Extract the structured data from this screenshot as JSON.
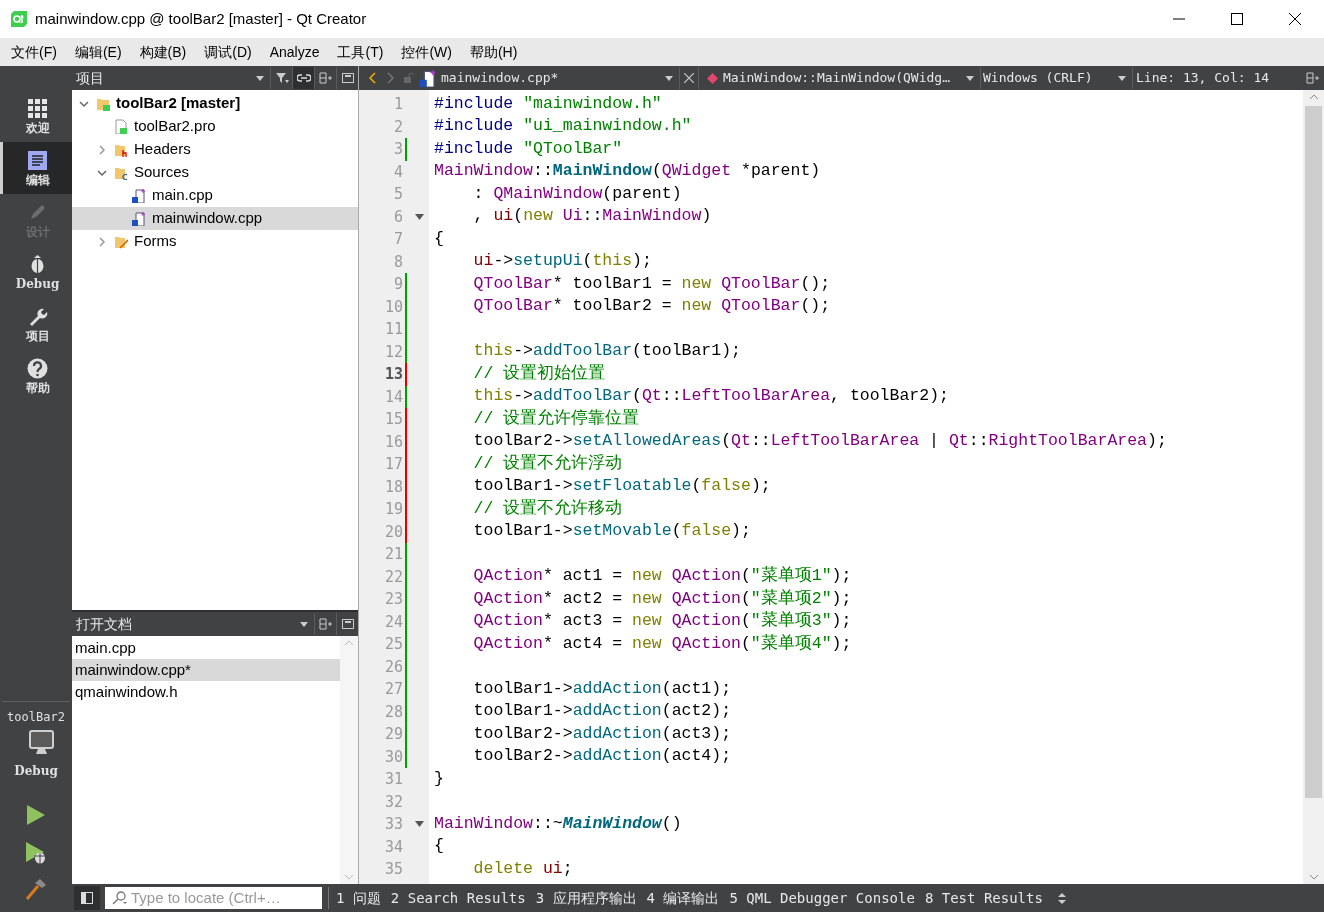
{
  "window": {
    "title": "mainwindow.cpp @ toolBar2 [master] - Qt Creator"
  },
  "menu": [
    {
      "label": "文件(F)"
    },
    {
      "label": "编辑(E)"
    },
    {
      "label": "构建(B)"
    },
    {
      "label": "调试(D)"
    },
    {
      "label": "Analyze"
    },
    {
      "label": "工具(T)"
    },
    {
      "label": "控件(W)"
    },
    {
      "label": "帮助(H)"
    }
  ],
  "mode_bar": {
    "items": [
      {
        "label": "欢迎",
        "kind": "welcome",
        "selected": false,
        "disabled": false
      },
      {
        "label": "编辑",
        "kind": "edit",
        "selected": true,
        "disabled": false
      },
      {
        "label": "设计",
        "kind": "design",
        "selected": false,
        "disabled": true
      },
      {
        "label": "Debug",
        "kind": "debug",
        "selected": false,
        "disabled": false
      },
      {
        "label": "项目",
        "kind": "projects",
        "selected": false,
        "disabled": false
      },
      {
        "label": "帮助",
        "kind": "help",
        "selected": false,
        "disabled": false
      }
    ],
    "kit": {
      "project": "toolBar2",
      "build": "Debug"
    }
  },
  "project_panel": {
    "title": "项目",
    "tree": [
      {
        "label": "toolBar2 [master]",
        "kind": "project",
        "expanded": true,
        "selected": false,
        "children": [
          {
            "label": "toolBar2.pro",
            "kind": "pro",
            "selected": false
          },
          {
            "label": "Headers",
            "kind": "headers",
            "expanded": false,
            "selected": false
          },
          {
            "label": "Sources",
            "kind": "sources",
            "expanded": true,
            "selected": false,
            "children": [
              {
                "label": "main.cpp",
                "kind": "cpp",
                "selected": false
              },
              {
                "label": "mainwindow.cpp",
                "kind": "cpp",
                "selected": true
              }
            ]
          },
          {
            "label": "Forms",
            "kind": "forms",
            "expanded": false,
            "selected": false
          }
        ]
      }
    ]
  },
  "open_documents": {
    "title": "打开文档",
    "items": [
      {
        "label": "main.cpp",
        "selected": false
      },
      {
        "label": "mainwindow.cpp*",
        "selected": true
      },
      {
        "label": "qmainwindow.h",
        "selected": false
      }
    ]
  },
  "editor": {
    "file": "mainwindow.cpp*",
    "symbol": "MainWindow::MainWindow(QWidg…",
    "line_ending": "Windows (CRLF)",
    "position": "Line: 13, Col: 14",
    "lines": [
      {
        "number": "1",
        "added": false,
        "modified": false,
        "fold": false,
        "current": false,
        "indented": false,
        "tokens": [
          {
            "kind": "preprocessor",
            "text": "#include "
          },
          {
            "kind": "string",
            "text": "\"mainwindow.h\""
          }
        ]
      },
      {
        "number": "2",
        "added": false,
        "modified": false,
        "fold": false,
        "current": false,
        "indented": false,
        "tokens": [
          {
            "kind": "preprocessor",
            "text": "#include "
          },
          {
            "kind": "string",
            "text": "\"ui_mainwindow.h\""
          }
        ]
      },
      {
        "number": "3",
        "added": true,
        "modified": false,
        "fold": false,
        "current": false,
        "indented": false,
        "tokens": [
          {
            "kind": "preprocessor",
            "text": "#include "
          },
          {
            "kind": "string",
            "text": "\"QToolBar\""
          }
        ]
      },
      {
        "number": "4",
        "added": false,
        "modified": false,
        "fold": false,
        "current": false,
        "indented": false,
        "tokens": [
          {
            "kind": "type",
            "text": "MainWindow"
          },
          {
            "kind": "plain",
            "text": "::"
          },
          {
            "kind": "declaration",
            "text": "MainWindow"
          },
          {
            "kind": "plain",
            "text": "("
          },
          {
            "kind": "type",
            "text": "QWidget"
          },
          {
            "kind": "plain",
            "text": " *parent)"
          }
        ]
      },
      {
        "number": "5",
        "added": false,
        "modified": false,
        "fold": false,
        "current": false,
        "indented": true,
        "tokens": [
          {
            "kind": "plain",
            "text": ": "
          },
          {
            "kind": "type",
            "text": "QMainWindow"
          },
          {
            "kind": "plain",
            "text": "(parent)"
          }
        ]
      },
      {
        "number": "6",
        "added": false,
        "modified": false,
        "fold": true,
        "current": false,
        "indented": true,
        "tokens": [
          {
            "kind": "plain",
            "text": ", "
          },
          {
            "kind": "member",
            "text": "ui"
          },
          {
            "kind": "plain",
            "text": "("
          },
          {
            "kind": "keyword",
            "text": "new "
          },
          {
            "kind": "type",
            "text": "Ui"
          },
          {
            "kind": "plain",
            "text": "::"
          },
          {
            "kind": "type",
            "text": "MainWindow"
          },
          {
            "kind": "plain",
            "text": ")"
          }
        ]
      },
      {
        "number": "7",
        "added": false,
        "modified": false,
        "fold": false,
        "current": false,
        "indented": false,
        "tokens": [
          {
            "kind": "plain",
            "text": "{"
          }
        ]
      },
      {
        "number": "8",
        "added": false,
        "modified": false,
        "fold": false,
        "current": false,
        "indented": true,
        "tokens": [
          {
            "kind": "member",
            "text": "ui"
          },
          {
            "kind": "plain",
            "text": "->"
          },
          {
            "kind": "function",
            "text": "setupUi"
          },
          {
            "kind": "plain",
            "text": "("
          },
          {
            "kind": "keyword",
            "text": "this"
          },
          {
            "kind": "plain",
            "text": ");"
          }
        ]
      },
      {
        "number": "9",
        "added": true,
        "modified": false,
        "fold": false,
        "current": false,
        "indented": true,
        "tokens": [
          {
            "kind": "type",
            "text": "QToolBar"
          },
          {
            "kind": "plain",
            "text": "* toolBar1 = "
          },
          {
            "kind": "keyword",
            "text": "new "
          },
          {
            "kind": "type",
            "text": "QToolBar"
          },
          {
            "kind": "plain",
            "text": "();"
          }
        ]
      },
      {
        "number": "10",
        "added": true,
        "modified": false,
        "fold": false,
        "current": false,
        "indented": true,
        "tokens": [
          {
            "kind": "type",
            "text": "QToolBar"
          },
          {
            "kind": "plain",
            "text": "* toolBar2 = "
          },
          {
            "kind": "keyword",
            "text": "new "
          },
          {
            "kind": "type",
            "text": "QToolBar"
          },
          {
            "kind": "plain",
            "text": "();"
          }
        ]
      },
      {
        "number": "11",
        "added": true,
        "modified": false,
        "fold": false,
        "current": false
      },
      {
        "number": "12",
        "added": true,
        "modified": false,
        "fold": false,
        "current": false,
        "indented": true,
        "tokens": [
          {
            "kind": "keyword",
            "text": "this"
          },
          {
            "kind": "plain",
            "text": "->"
          },
          {
            "kind": "function",
            "text": "addToolBar"
          },
          {
            "kind": "plain",
            "text": "(toolBar1);"
          }
        ]
      },
      {
        "number": "13",
        "added": false,
        "modified": true,
        "fold": false,
        "current": true,
        "indented": true,
        "tokens": [
          {
            "kind": "comment",
            "text": "// 设置初始位置"
          }
        ]
      },
      {
        "number": "14",
        "added": true,
        "modified": false,
        "fold": false,
        "current": false,
        "indented": true,
        "tokens": [
          {
            "kind": "keyword",
            "text": "this"
          },
          {
            "kind": "plain",
            "text": "->"
          },
          {
            "kind": "function",
            "text": "addToolBar"
          },
          {
            "kind": "plain",
            "text": "("
          },
          {
            "kind": "type",
            "text": "Qt"
          },
          {
            "kind": "plain",
            "text": "::"
          },
          {
            "kind": "type",
            "text": "LeftToolBarArea"
          },
          {
            "kind": "plain",
            "text": ", toolBar2);"
          }
        ]
      },
      {
        "number": "15",
        "added": false,
        "modified": true,
        "fold": false,
        "current": false,
        "indented": true,
        "tokens": [
          {
            "kind": "comment",
            "text": "// 设置允许停靠位置"
          }
        ]
      },
      {
        "number": "16",
        "added": false,
        "modified": true,
        "fold": false,
        "current": false,
        "indented": true,
        "tokens": [
          {
            "kind": "plain",
            "text": "toolBar2->"
          },
          {
            "kind": "function",
            "text": "setAllowedAreas"
          },
          {
            "kind": "plain",
            "text": "("
          },
          {
            "kind": "type",
            "text": "Qt"
          },
          {
            "kind": "plain",
            "text": "::"
          },
          {
            "kind": "type",
            "text": "LeftToolBarArea"
          },
          {
            "kind": "plain",
            "text": " | "
          },
          {
            "kind": "type",
            "text": "Qt"
          },
          {
            "kind": "plain",
            "text": "::"
          },
          {
            "kind": "type",
            "text": "RightToolBarArea"
          },
          {
            "kind": "plain",
            "text": ");"
          }
        ]
      },
      {
        "number": "17",
        "added": false,
        "modified": true,
        "fold": false,
        "current": false,
        "indented": true,
        "tokens": [
          {
            "kind": "comment",
            "text": "// 设置不允许浮动"
          }
        ]
      },
      {
        "number": "18",
        "added": false,
        "modified": true,
        "fold": false,
        "current": false,
        "indented": true,
        "tokens": [
          {
            "kind": "plain",
            "text": "toolBar1->"
          },
          {
            "kind": "function",
            "text": "setFloatable"
          },
          {
            "kind": "plain",
            "text": "("
          },
          {
            "kind": "keyword",
            "text": "false"
          },
          {
            "kind": "plain",
            "text": ");"
          }
        ]
      },
      {
        "number": "19",
        "added": false,
        "modified": true,
        "fold": false,
        "current": false,
        "indented": true,
        "tokens": [
          {
            "kind": "comment",
            "text": "// 设置不允许移动"
          }
        ]
      },
      {
        "number": "20",
        "added": false,
        "modified": true,
        "fold": false,
        "current": false,
        "indented": true,
        "tokens": [
          {
            "kind": "plain",
            "text": "toolBar1->"
          },
          {
            "kind": "function",
            "text": "setMovable"
          },
          {
            "kind": "plain",
            "text": "("
          },
          {
            "kind": "keyword",
            "text": "false"
          },
          {
            "kind": "plain",
            "text": ");"
          }
        ]
      },
      {
        "number": "21",
        "added": true,
        "modified": false,
        "fold": false,
        "current": false
      },
      {
        "number": "22",
        "added": true,
        "modified": false,
        "fold": false,
        "current": false,
        "indented": true,
        "tokens": [
          {
            "kind": "type",
            "text": "QAction"
          },
          {
            "kind": "plain",
            "text": "* act1 = "
          },
          {
            "kind": "keyword",
            "text": "new "
          },
          {
            "kind": "type",
            "text": "QAction"
          },
          {
            "kind": "plain",
            "text": "("
          },
          {
            "kind": "string",
            "text": "\"菜单项1\""
          },
          {
            "kind": "plain",
            "text": ");"
          }
        ]
      },
      {
        "number": "23",
        "added": true,
        "modified": false,
        "fold": false,
        "current": false,
        "indented": true,
        "tokens": [
          {
            "kind": "type",
            "text": "QAction"
          },
          {
            "kind": "plain",
            "text": "* act2 = "
          },
          {
            "kind": "keyword",
            "text": "new "
          },
          {
            "kind": "type",
            "text": "QAction"
          },
          {
            "kind": "plain",
            "text": "("
          },
          {
            "kind": "string",
            "text": "\"菜单项2\""
          },
          {
            "kind": "plain",
            "text": ");"
          }
        ]
      },
      {
        "number": "24",
        "added": true,
        "modified": false,
        "fold": false,
        "current": false,
        "indented": true,
        "tokens": [
          {
            "kind": "type",
            "text": "QAction"
          },
          {
            "kind": "plain",
            "text": "* act3 = "
          },
          {
            "kind": "keyword",
            "text": "new "
          },
          {
            "kind": "type",
            "text": "QAction"
          },
          {
            "kind": "plain",
            "text": "("
          },
          {
            "kind": "string",
            "text": "\"菜单项3\""
          },
          {
            "kind": "plain",
            "text": ");"
          }
        ]
      },
      {
        "number": "25",
        "added": true,
        "modified": false,
        "fold": false,
        "current": false,
        "indented": true,
        "tokens": [
          {
            "kind": "type",
            "text": "QAction"
          },
          {
            "kind": "plain",
            "text": "* act4 = "
          },
          {
            "kind": "keyword",
            "text": "new "
          },
          {
            "kind": "type",
            "text": "QAction"
          },
          {
            "kind": "plain",
            "text": "("
          },
          {
            "kind": "string",
            "text": "\"菜单项4\""
          },
          {
            "kind": "plain",
            "text": ");"
          }
        ]
      },
      {
        "number": "26",
        "added": true,
        "modified": false,
        "fold": false,
        "current": false
      },
      {
        "number": "27",
        "added": true,
        "modified": false,
        "fold": false,
        "current": false,
        "indented": true,
        "tokens": [
          {
            "kind": "plain",
            "text": "toolBar1->"
          },
          {
            "kind": "function",
            "text": "addAction"
          },
          {
            "kind": "plain",
            "text": "(act1);"
          }
        ]
      },
      {
        "number": "28",
        "added": true,
        "modified": false,
        "fold": false,
        "current": false,
        "indented": true,
        "tokens": [
          {
            "kind": "plain",
            "text": "toolBar1->"
          },
          {
            "kind": "function",
            "text": "addAction"
          },
          {
            "kind": "plain",
            "text": "(act2);"
          }
        ]
      },
      {
        "number": "29",
        "added": true,
        "modified": false,
        "fold": false,
        "current": false,
        "indented": true,
        "tokens": [
          {
            "kind": "plain",
            "text": "toolBar2->"
          },
          {
            "kind": "function",
            "text": "addAction"
          },
          {
            "kind": "plain",
            "text": "(act3);"
          }
        ]
      },
      {
        "number": "30",
        "added": true,
        "modified": false,
        "fold": false,
        "current": false,
        "indented": true,
        "tokens": [
          {
            "kind": "plain",
            "text": "toolBar2->"
          },
          {
            "kind": "function",
            "text": "addAction"
          },
          {
            "kind": "plain",
            "text": "(act4);"
          }
        ]
      },
      {
        "number": "31",
        "added": false,
        "modified": false,
        "fold": false,
        "current": false,
        "indented": false,
        "tokens": [
          {
            "kind": "plain",
            "text": "}"
          }
        ]
      },
      {
        "number": "32",
        "added": false,
        "modified": false,
        "fold": false,
        "current": false
      },
      {
        "number": "33",
        "added": false,
        "modified": false,
        "fold": true,
        "current": false,
        "indented": false,
        "tokens": [
          {
            "kind": "type",
            "text": "MainWindow"
          },
          {
            "kind": "plain",
            "text": "::~"
          },
          {
            "kind": "destructor",
            "text": "MainWindow"
          },
          {
            "kind": "plain",
            "text": "()"
          }
        ]
      },
      {
        "number": "34",
        "added": false,
        "modified": false,
        "fold": false,
        "current": false,
        "indented": false,
        "tokens": [
          {
            "kind": "plain",
            "text": "{"
          }
        ]
      },
      {
        "number": "35",
        "added": false,
        "modified": false,
        "fold": false,
        "current": false,
        "indented": true,
        "tokens": [
          {
            "kind": "keyword",
            "text": "delete "
          },
          {
            "kind": "member",
            "text": "ui"
          },
          {
            "kind": "plain",
            "text": ";"
          }
        ]
      }
    ]
  },
  "locator": {
    "placeholder": "Type to locate (Ctrl+…"
  },
  "output_tabs": [
    "1 问题",
    "2 Search Results",
    "3 应用程序输出",
    "4 编译输出",
    "5 QML Debugger Console",
    "8 Test Results"
  ]
}
